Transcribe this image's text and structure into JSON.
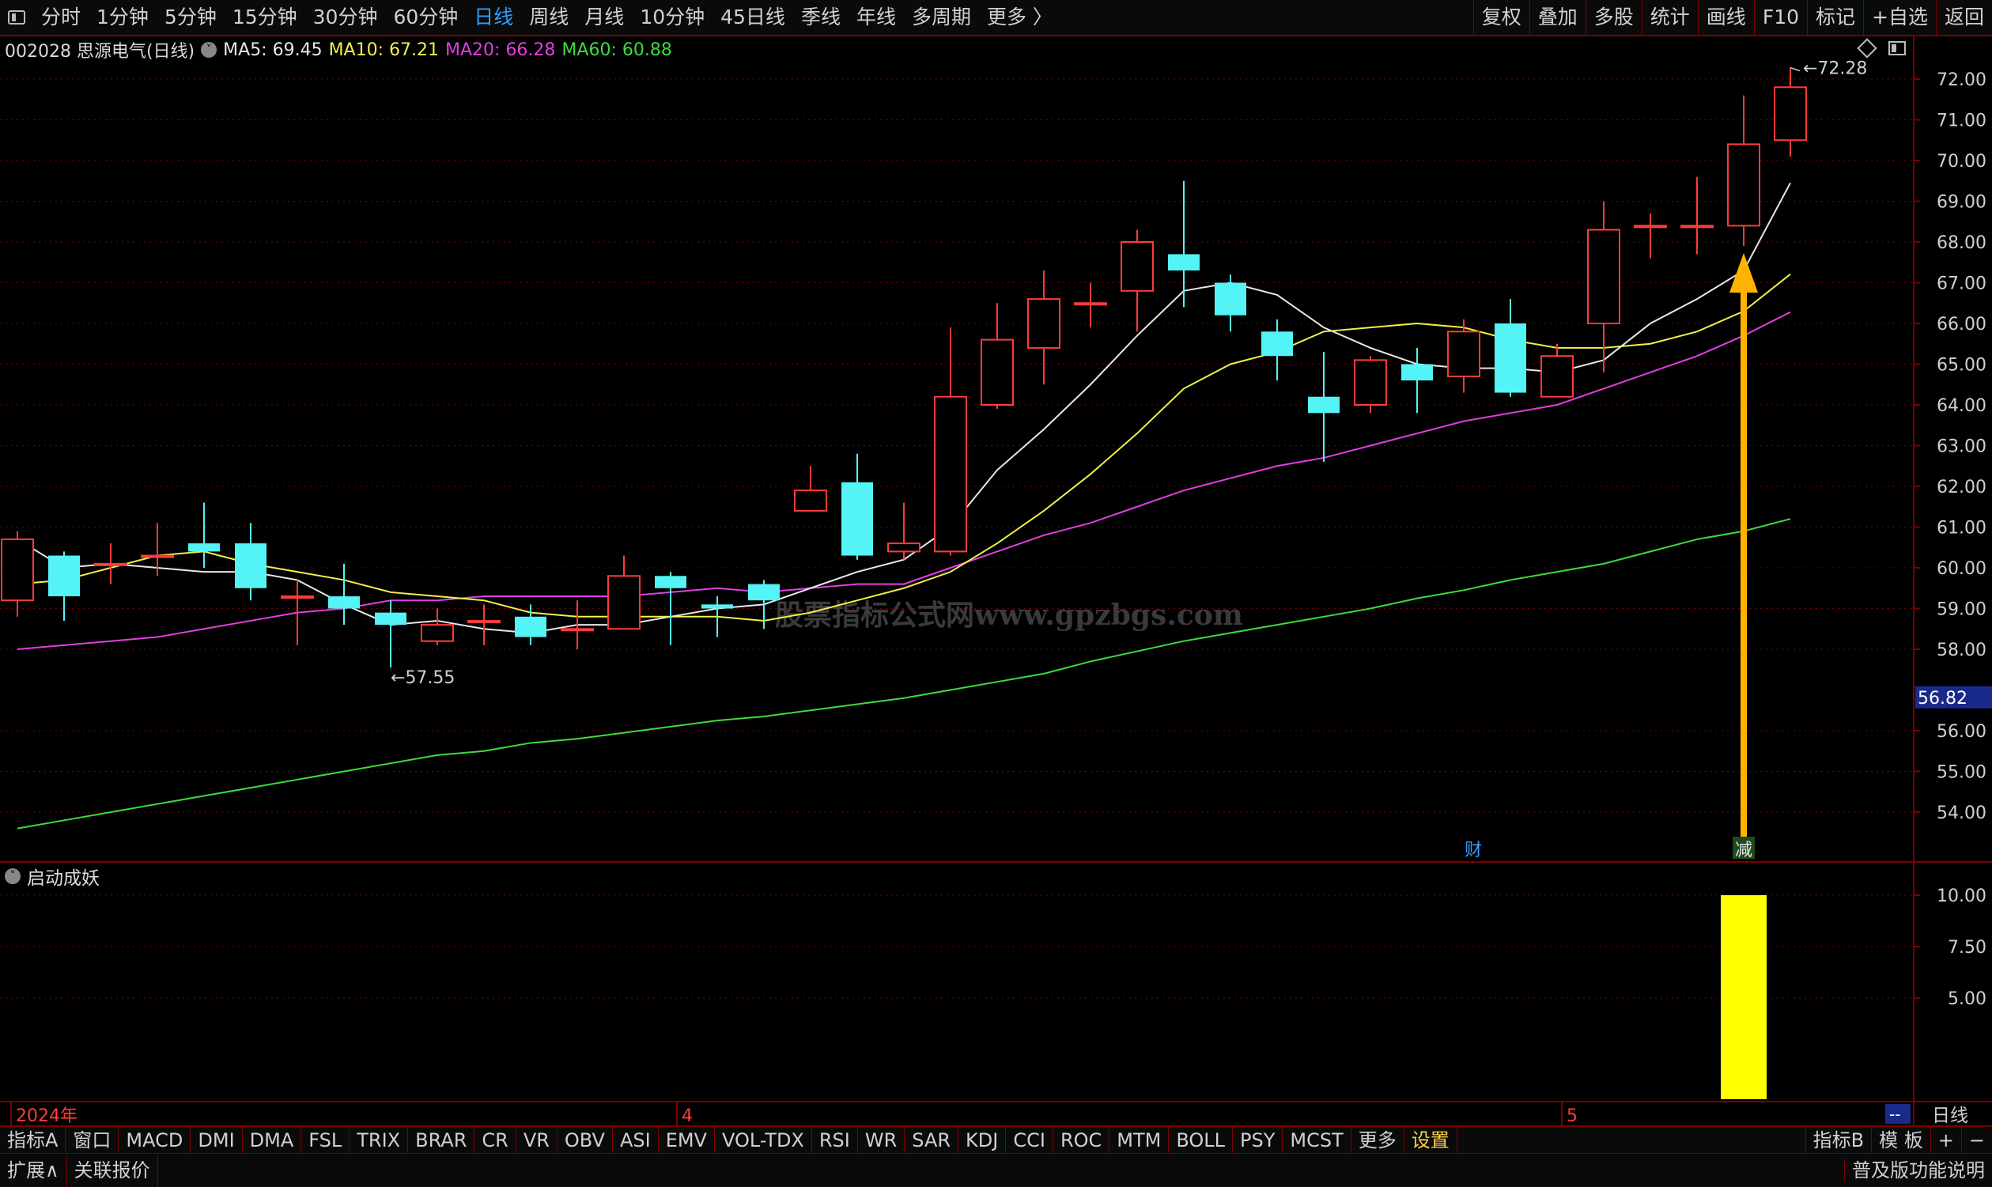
{
  "toolbar": {
    "periods": [
      "分时",
      "1分钟",
      "5分钟",
      "15分钟",
      "30分钟",
      "60分钟",
      "日线",
      "周线",
      "月线",
      "10分钟",
      "45日线",
      "季线",
      "年线",
      "多周期",
      "更多 〉"
    ],
    "active_period": "日线",
    "right_buttons": [
      "复权",
      "叠加",
      "多股",
      "统计",
      "画线",
      "F10",
      "标记",
      "+自选",
      "返回"
    ]
  },
  "info": {
    "code_name": "002028 思源电气(日线)",
    "ma5": "MA5: 69.45",
    "ma10": "MA10: 67.21",
    "ma20": "MA20: 66.28",
    "ma60": "MA60: 60.88"
  },
  "colors": {
    "up": "#ff3b3b",
    "down": "#54f3f5",
    "ma5": "#e8e8e8",
    "ma10": "#f0f04a",
    "ma20": "#e23ee2",
    "ma60": "#3ddb3d",
    "arrow": "#ffb300",
    "volume": "#ffff00",
    "grid": "#7a0000",
    "axis_text": "#d0d0d0"
  },
  "main_axis": {
    "ticks": [
      "72.00",
      "71.00",
      "70.00",
      "69.00",
      "68.00",
      "67.00",
      "66.00",
      "65.00",
      "64.00",
      "63.00",
      "62.00",
      "61.00",
      "60.00",
      "59.00",
      "58.00",
      "56.00",
      "55.00",
      "54.00"
    ],
    "current_price": "56.82"
  },
  "annotations": {
    "high": "72.28",
    "low": "57.55",
    "marker_cai": "财",
    "marker_jian": "减",
    "watermark": "股票指标公式网www.gpzbgs.com"
  },
  "sub_chart": {
    "title": "启动成妖",
    "ticks": [
      "10.00",
      "7.50",
      "5.00"
    ]
  },
  "time_axis": {
    "labels": [
      "2024年",
      "4",
      "5"
    ],
    "period_label": "日线",
    "dash": "--"
  },
  "chart_data": {
    "type": "candlestick",
    "candles": [
      {
        "o": 59.2,
        "c": 60.7,
        "h": 60.9,
        "l": 58.8
      },
      {
        "o": 60.3,
        "c": 59.3,
        "h": 60.4,
        "l": 58.7
      },
      {
        "o": 60.1,
        "c": 60.1,
        "h": 60.6,
        "l": 59.6
      },
      {
        "o": 60.3,
        "c": 60.3,
        "h": 61.1,
        "l": 59.8
      },
      {
        "o": 60.6,
        "c": 60.4,
        "h": 61.6,
        "l": 60.0
      },
      {
        "o": 60.6,
        "c": 59.5,
        "h": 61.1,
        "l": 59.2
      },
      {
        "o": 59.3,
        "c": 59.3,
        "h": 59.7,
        "l": 58.1
      },
      {
        "o": 59.3,
        "c": 59.0,
        "h": 60.1,
        "l": 58.6
      },
      {
        "o": 58.9,
        "c": 58.6,
        "h": 59.2,
        "l": 57.55
      },
      {
        "o": 58.2,
        "c": 58.6,
        "h": 59.0,
        "l": 58.1
      },
      {
        "o": 58.7,
        "c": 58.7,
        "h": 59.1,
        "l": 58.1
      },
      {
        "o": 58.8,
        "c": 58.3,
        "h": 59.1,
        "l": 58.1
      },
      {
        "o": 58.5,
        "c": 58.5,
        "h": 59.2,
        "l": 58.0
      },
      {
        "o": 58.5,
        "c": 59.8,
        "h": 60.3,
        "l": 58.5
      },
      {
        "o": 59.8,
        "c": 59.5,
        "h": 59.9,
        "l": 58.1
      },
      {
        "o": 59.1,
        "c": 59.0,
        "h": 59.3,
        "l": 58.3
      },
      {
        "o": 59.6,
        "c": 59.2,
        "h": 59.7,
        "l": 58.5
      },
      {
        "o": 61.4,
        "c": 61.9,
        "h": 62.5,
        "l": 61.4
      },
      {
        "o": 62.1,
        "c": 60.3,
        "h": 62.8,
        "l": 60.2
      },
      {
        "o": 60.4,
        "c": 60.6,
        "h": 61.6,
        "l": 60.2
      },
      {
        "o": 60.4,
        "c": 64.2,
        "h": 65.9,
        "l": 60.3
      },
      {
        "o": 64.0,
        "c": 65.6,
        "h": 66.5,
        "l": 63.9
      },
      {
        "o": 65.4,
        "c": 66.6,
        "h": 67.3,
        "l": 64.5
      },
      {
        "o": 66.5,
        "c": 66.5,
        "h": 67.0,
        "l": 65.9
      },
      {
        "o": 66.8,
        "c": 68.0,
        "h": 68.3,
        "l": 65.8
      },
      {
        "o": 67.7,
        "c": 67.3,
        "h": 69.5,
        "l": 66.4
      },
      {
        "o": 67.0,
        "c": 66.2,
        "h": 67.2,
        "l": 65.8
      },
      {
        "o": 65.8,
        "c": 65.2,
        "h": 66.1,
        "l": 64.6
      },
      {
        "o": 64.2,
        "c": 63.8,
        "h": 65.3,
        "l": 62.6
      },
      {
        "o": 64.0,
        "c": 65.1,
        "h": 65.2,
        "l": 63.8
      },
      {
        "o": 65.0,
        "c": 64.6,
        "h": 65.4,
        "l": 63.8
      },
      {
        "o": 64.7,
        "c": 65.8,
        "h": 66.1,
        "l": 64.3
      },
      {
        "o": 66.0,
        "c": 64.3,
        "h": 66.6,
        "l": 64.2
      },
      {
        "o": 64.2,
        "c": 65.2,
        "h": 65.5,
        "l": 64.2
      },
      {
        "o": 66.0,
        "c": 68.3,
        "h": 69.0,
        "l": 64.8
      },
      {
        "o": 68.4,
        "c": 68.4,
        "h": 68.7,
        "l": 67.6
      },
      {
        "o": 68.4,
        "c": 68.4,
        "h": 69.6,
        "l": 67.7
      },
      {
        "o": 68.4,
        "c": 70.4,
        "h": 71.6,
        "l": 67.9
      },
      {
        "o": 70.5,
        "c": 71.8,
        "h": 72.28,
        "l": 70.1
      }
    ],
    "ma5": [
      60.7,
      60.0,
      60.1,
      60.0,
      59.9,
      59.9,
      59.7,
      59.1,
      58.6,
      58.7,
      58.5,
      58.4,
      58.6,
      58.6,
      58.8,
      59.0,
      59.1,
      59.5,
      59.9,
      60.2,
      61.0,
      62.4,
      63.4,
      64.5,
      65.7,
      66.8,
      67.0,
      66.7,
      65.9,
      65.4,
      65.0,
      64.9,
      64.9,
      64.8,
      65.1,
      66.0,
      66.6,
      67.3,
      69.45
    ],
    "ma10": [
      59.6,
      59.7,
      60.0,
      60.3,
      60.4,
      60.1,
      59.9,
      59.7,
      59.4,
      59.3,
      59.2,
      58.9,
      58.8,
      58.8,
      58.8,
      58.8,
      58.7,
      58.9,
      59.2,
      59.5,
      59.9,
      60.6,
      61.4,
      62.3,
      63.3,
      64.4,
      65.0,
      65.3,
      65.8,
      65.9,
      66.0,
      65.9,
      65.6,
      65.4,
      65.4,
      65.5,
      65.8,
      66.3,
      67.21
    ],
    "ma20": [
      58.0,
      58.1,
      58.2,
      58.3,
      58.5,
      58.7,
      58.9,
      59.0,
      59.2,
      59.2,
      59.3,
      59.3,
      59.3,
      59.3,
      59.4,
      59.5,
      59.4,
      59.5,
      59.6,
      59.6,
      60.0,
      60.4,
      60.8,
      61.1,
      61.5,
      61.9,
      62.2,
      62.5,
      62.7,
      63.0,
      63.3,
      63.6,
      63.8,
      64.0,
      64.4,
      64.8,
      65.2,
      65.7,
      66.28
    ],
    "ma60": [
      53.6,
      53.8,
      54.0,
      54.2,
      54.4,
      54.6,
      54.8,
      55.0,
      55.2,
      55.4,
      55.5,
      55.7,
      55.8,
      55.95,
      56.1,
      56.25,
      56.35,
      56.5,
      56.65,
      56.8,
      57.0,
      57.2,
      57.4,
      57.7,
      57.95,
      58.2,
      58.4,
      58.6,
      58.8,
      59.0,
      59.25,
      59.45,
      59.7,
      59.9,
      60.1,
      60.4,
      60.7,
      60.9,
      61.2
    ],
    "signal": {
      "index": 37,
      "value": 10.0
    },
    "y_range": [
      53.3,
      72.5
    ],
    "sub_y_range": [
      0,
      10.0
    ]
  }
}
